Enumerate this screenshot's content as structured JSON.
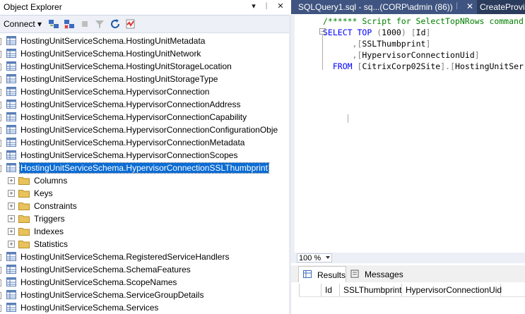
{
  "object_explorer": {
    "title": "Object Explorer",
    "connect_label": "Connect ▾",
    "title_buttons": [
      "▾",
      "ᛁ",
      "✕"
    ],
    "toolbar_icons": [
      "connect-object-explorer-icon",
      "disconnect-icon",
      "stop-icon",
      "filter-icon",
      "refresh-icon",
      "activity-monitor-icon"
    ],
    "tree_items": [
      {
        "label": "HostingUnitServiceSchema.HostingUnitMetadata",
        "type": "table"
      },
      {
        "label": "HostingUnitServiceSchema.HostingUnitNetwork",
        "type": "table"
      },
      {
        "label": "HostingUnitServiceSchema.HostingUnitStorageLocation",
        "type": "table"
      },
      {
        "label": "HostingUnitServiceSchema.HostingUnitStorageType",
        "type": "table"
      },
      {
        "label": "HostingUnitServiceSchema.HypervisorConnection",
        "type": "table"
      },
      {
        "label": "HostingUnitServiceSchema.HypervisorConnectionAddress",
        "type": "table"
      },
      {
        "label": "HostingUnitServiceSchema.HypervisorConnectionCapability",
        "type": "table"
      },
      {
        "label": "HostingUnitServiceSchema.HypervisorConnectionConfigurationObje",
        "type": "table"
      },
      {
        "label": "HostingUnitServiceSchema.HypervisorConnectionMetadata",
        "type": "table"
      },
      {
        "label": "HostingUnitServiceSchema.HypervisorConnectionScopes",
        "type": "table"
      },
      {
        "label": "HostingUnitServiceSchema.HypervisorConnectionSSLThumbprint",
        "type": "table",
        "selected": true
      },
      {
        "label": "Columns",
        "type": "folder"
      },
      {
        "label": "Keys",
        "type": "folder"
      },
      {
        "label": "Constraints",
        "type": "folder"
      },
      {
        "label": "Triggers",
        "type": "folder"
      },
      {
        "label": "Indexes",
        "type": "folder"
      },
      {
        "label": "Statistics",
        "type": "folder"
      },
      {
        "label": "HostingUnitServiceSchema.RegisteredServiceHandlers",
        "type": "table"
      },
      {
        "label": "HostingUnitServiceSchema.SchemaFeatures",
        "type": "table"
      },
      {
        "label": "HostingUnitServiceSchema.ScopeNames",
        "type": "table"
      },
      {
        "label": "HostingUnitServiceSchema.ServiceGroupDetails",
        "type": "table"
      },
      {
        "label": "HostingUnitServiceSchema.Services",
        "type": "table"
      }
    ]
  },
  "tabs": {
    "active_label": "SQLQuery1.sql - sq...(CORP\\admin (86))",
    "pin": "ᛁ",
    "close": "✕",
    "second_label": "CreateProvis"
  },
  "editor": {
    "lines": [
      "/****** Script for SelectTopNRows command",
      "SELECT TOP (1000) [Id]",
      "      ,[SSLThumbprint]",
      "      ,[HypervisorConnectionUid]",
      "  FROM [CitrixCorp02Site].[HostingUnitSer"
    ]
  },
  "zoom": "100 %",
  "results": {
    "tabs": [
      "Results",
      "Messages"
    ],
    "columns": [
      "Id",
      "SSLThumbprint",
      "HypervisorConnectionUid"
    ]
  },
  "colors": {
    "selection": "#0b6cd4",
    "tab_active": "#3f5480",
    "tab_bar": "#2b3b5c",
    "keyword": "#0000ff",
    "comment": "#008000"
  }
}
